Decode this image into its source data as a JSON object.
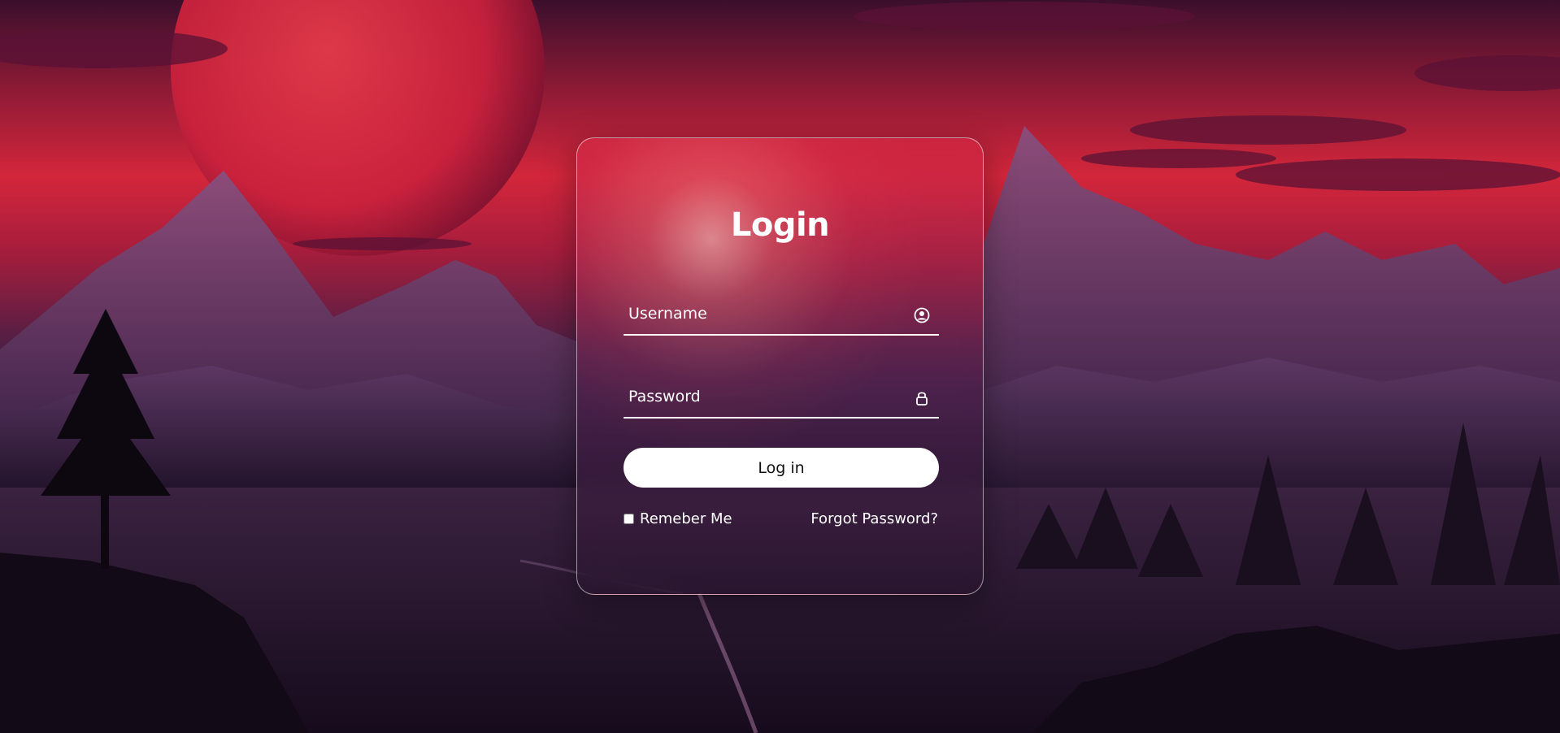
{
  "login": {
    "title": "Login",
    "username_placeholder": "Username",
    "password_placeholder": "Password",
    "submit_label": "Log in",
    "remember_label": "Remeber Me",
    "forgot_label": "Forgot Password?"
  },
  "icons": {
    "username": "user-circle-icon",
    "password": "lock-icon"
  },
  "colors": {
    "accent": "#d3263b",
    "text": "#ffffff",
    "button_bg": "#ffffff",
    "button_text": "#111111"
  }
}
